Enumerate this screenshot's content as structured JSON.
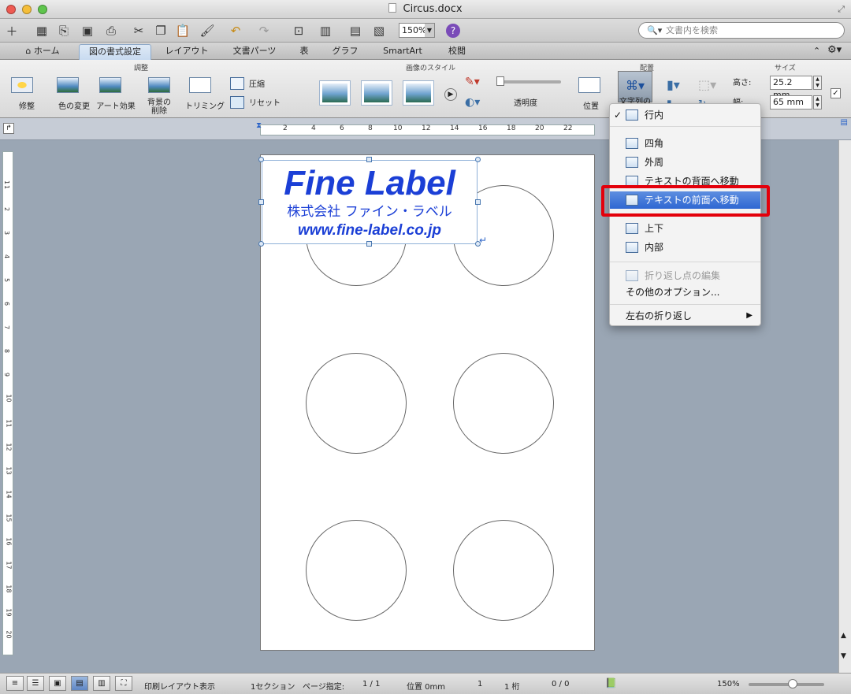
{
  "window": {
    "title": "Circus.docx"
  },
  "toolbar": {
    "zoom": "150%",
    "search_placeholder": "文書内を検索"
  },
  "tabs": [
    {
      "label": "ホーム"
    },
    {
      "label": "図の書式設定"
    },
    {
      "label": "レイアウト"
    },
    {
      "label": "文書パーツ"
    },
    {
      "label": "表"
    },
    {
      "label": "グラフ"
    },
    {
      "label": "SmartArt"
    },
    {
      "label": "校閲"
    }
  ],
  "ribbon": {
    "groups": {
      "adjust": "調整",
      "styles": "画像のスタイル",
      "arrange": "配置",
      "size": "サイズ"
    },
    "adjust": {
      "correct": "修整",
      "recolor": "色の変更",
      "art": "アート効果",
      "remove_bg_1": "背景の",
      "remove_bg_2": "削除",
      "trim": "トリミング",
      "compress": "圧縮",
      "reset": "リセット"
    },
    "transparency": "透明度",
    "position": "位置",
    "wrap": "文字列の",
    "height_label": "高さ:",
    "height_value": "25.2 mm",
    "width_label": "幅:",
    "width_value": "65 mm"
  },
  "ruler": {
    "marks": [
      "2",
      "4",
      "6",
      "8",
      "10",
      "12",
      "14",
      "16",
      "18",
      "20",
      "22"
    ]
  },
  "vruler": {
    "marks": [
      "1",
      "1",
      "2",
      "3",
      "4",
      "5",
      "6",
      "7",
      "8",
      "9",
      "10",
      "11",
      "12",
      "13",
      "14",
      "15",
      "16",
      "17",
      "18",
      "19",
      "20"
    ]
  },
  "label": {
    "title": "Fine Label",
    "company": "株式会社 ファイン・ラベル",
    "url": "www.fine-label.co.jp"
  },
  "wrap_menu": {
    "check": "✓",
    "items": [
      {
        "label": "行内"
      },
      {
        "label": "四角"
      },
      {
        "label": "外周"
      },
      {
        "label": "テキストの背面へ移動"
      },
      {
        "label": "テキストの前面へ移動"
      },
      {
        "label": "上下"
      },
      {
        "label": "内部"
      },
      {
        "label": "折り返し点の編集"
      },
      {
        "label": "その他のオプション..."
      },
      {
        "label": "左右の折り返し"
      }
    ],
    "submenu_arrow": "▶"
  },
  "status": {
    "view": "印刷レイアウト表示",
    "section": "1セクション",
    "page_label": "ページ指定:",
    "page_value": "1 / 1",
    "position": "位置 0mm",
    "line": "1",
    "column": "1 桁",
    "words": "0 / 0",
    "zoom": "150%"
  },
  "colors": {
    "highlight": "#2f67d2",
    "annotation": "#e3000b",
    "brand_blue": "#1b3fd6"
  }
}
